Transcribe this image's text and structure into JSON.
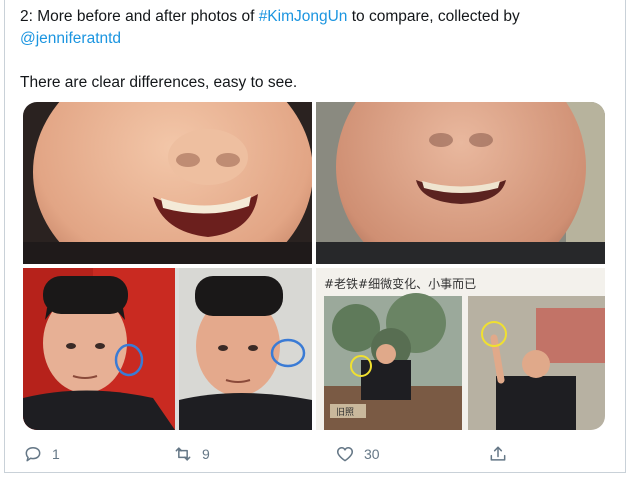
{
  "tweet": {
    "text_line1_prefix": "2: More before and after photos of ",
    "hashtag": "#KimJongUn",
    "text_line1_suffix": " to compare, collected by",
    "mention": "@jenniferatntd",
    "text_line2": "There are clear differences, easy to see."
  },
  "media": {
    "photo4_caption": "#老铁#细微变化、小事而已",
    "photo4_sign": "旧照"
  },
  "actions": {
    "reply_count": "1",
    "retweet_count": "9",
    "like_count": "30"
  },
  "colors": {
    "link": "#1b95e0",
    "action_gray": "#657786",
    "circle_annotation": "#3a7bd5",
    "circle_yellow": "#f0e030"
  },
  "icons": [
    "reply-icon",
    "retweet-icon",
    "like-icon",
    "share-icon"
  ]
}
